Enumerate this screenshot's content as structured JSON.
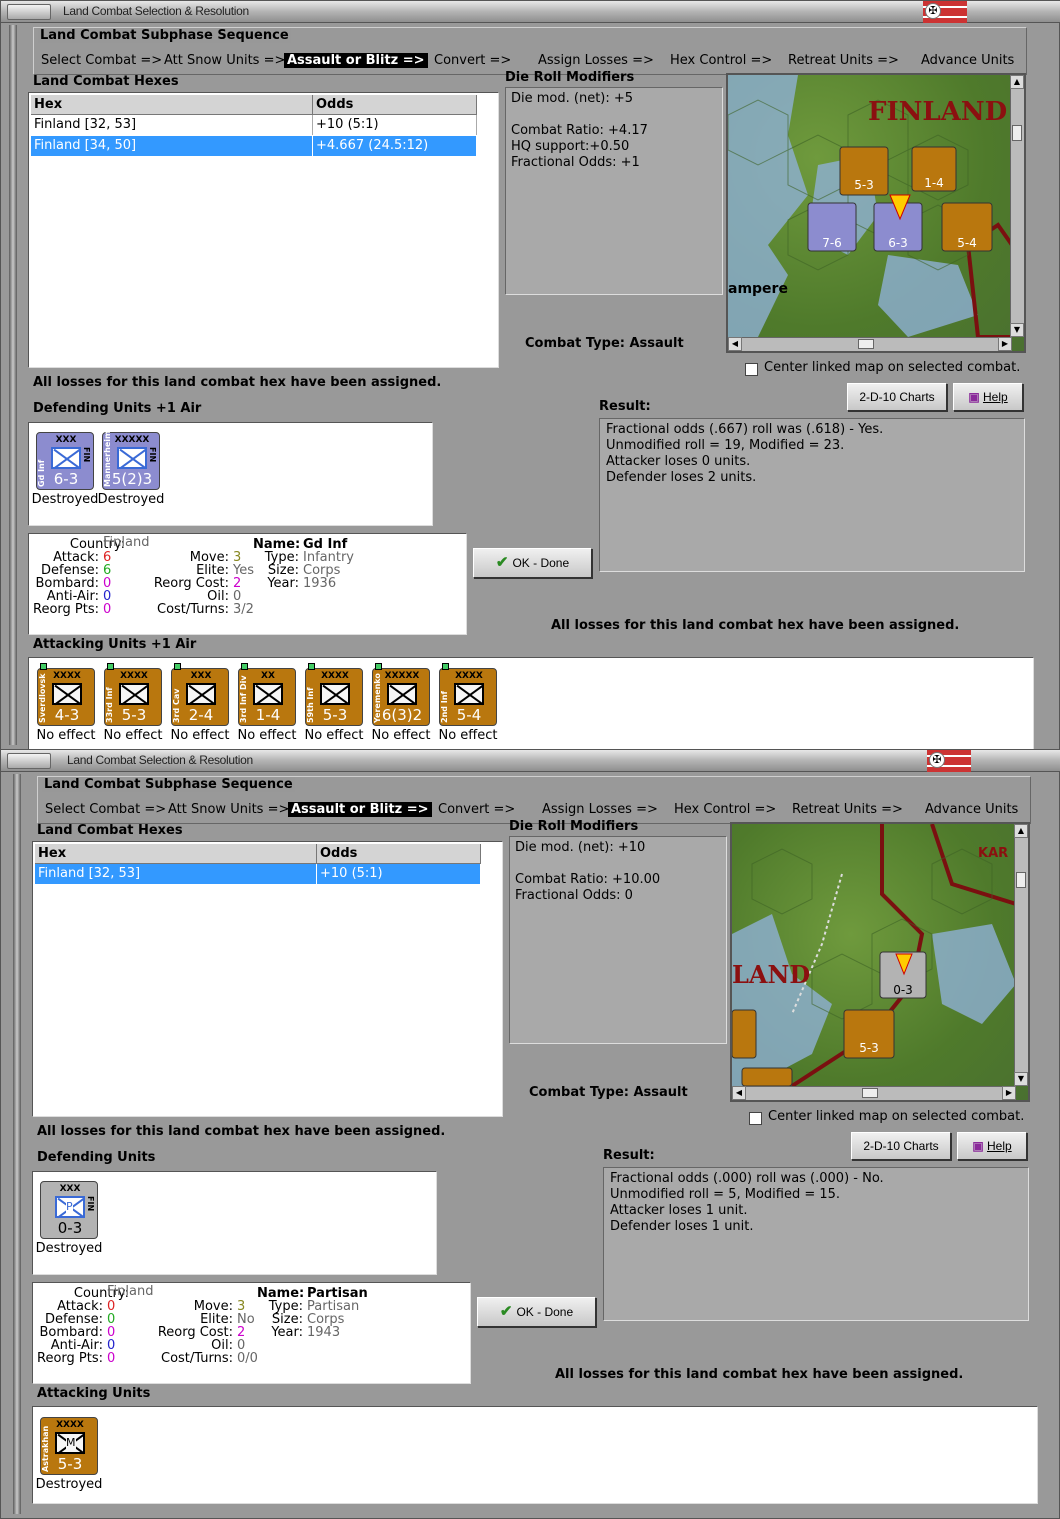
{
  "windows": [
    {
      "title": "Land Combat Selection & Resolution",
      "sequence_title": "Land Combat Subphase Sequence",
      "sequence": [
        "Select Combat =>",
        "Att Snow Units =>",
        "Assault or Blitz =>",
        "Convert =>",
        "Assign Losses =>",
        "Hex Control =>",
        "Retreat Units =>",
        "Advance Units"
      ],
      "hexes_title": "Land Combat Hexes",
      "hex_col": "Hex",
      "odds_col": "Odds",
      "hex_rows": [
        {
          "hex": "Finland [32, 53]",
          "odds": "+10 (5:1)"
        },
        {
          "hex": "Finland [34, 50]",
          "odds": "+4.667 (24.5:12)"
        }
      ],
      "drm_title": "Die Roll Modifiers",
      "drm_lines": [
        "Die mod. (net): +5",
        "",
        "Combat Ratio: +4.17",
        "HQ support:+0.50",
        "Fractional Odds: +1"
      ],
      "map_label": "FINLAND",
      "map_label2": "ampere",
      "combat_type": "Combat Type:  Assault",
      "center_linked": "Center linked map on selected combat.",
      "losses_assigned": "All losses for this land combat hex have been assigned.",
      "charts_btn": "2-D-10 Charts",
      "help_btn": "Help",
      "result_title": "Result:",
      "result_lines": [
        "Fractional odds (.667) roll was (.618)  - Yes.",
        "Unmodified roll = 19, Modified = 23.",
        "Attacker loses 0 units.",
        "Defender loses 2 units."
      ],
      "defending_title": "Defending Units +1 Air",
      "defenders": [
        {
          "size": "XXX",
          "name": "Gd Inf",
          "str": "6-3",
          "status": "Destroyed",
          "nat": "FIN"
        },
        {
          "size": "XXXXX",
          "name": "Mannerheim",
          "str": "5(2)3",
          "status": "Destroyed",
          "nat": "FIN"
        }
      ],
      "info": {
        "country_l": "Country:",
        "country": "Finland",
        "attack_l": "Attack:",
        "attack": "6",
        "defense_l": "Defense:",
        "defense": "6",
        "bombard_l": "Bombard:",
        "bombard": "0",
        "aa_l": "Anti-Air:",
        "aa": "0",
        "reorg_l": "Reorg Pts:",
        "reorg": "0",
        "move_l": "Move:",
        "move": "3",
        "elite_l": "Elite:",
        "elite": "Yes",
        "rcost_l": "Reorg Cost:",
        "rcost": "2",
        "oil_l": "Oil:",
        "oil": "0",
        "cost_l": "Cost/Turns:",
        "cost": "3/2",
        "name_l": "Name:",
        "name": "Gd Inf",
        "type_l": "Type:",
        "type": "Infantry",
        "size_l": "Size:",
        "size": "Corps",
        "year_l": "Year:",
        "year": "1936"
      },
      "ok_btn": "OK - Done",
      "attacking_title": "Attacking Units +1 Air",
      "attackers": [
        {
          "size": "XXXX",
          "name": "Sverdlovsk",
          "str": "4-3",
          "status": "No effect"
        },
        {
          "size": "XXXX",
          "name": "33rd Inf",
          "str": "5-3",
          "status": "No effect"
        },
        {
          "size": "XXX",
          "name": "3rd Cav",
          "str": "2-4",
          "status": "No effect"
        },
        {
          "size": "XX",
          "name": "3rd Inf Div",
          "str": "1-4",
          "status": "No effect"
        },
        {
          "size": "XXXX",
          "name": "59th Inf",
          "str": "5-3",
          "status": "No effect"
        },
        {
          "size": "XXXXX",
          "name": "Yeremenko",
          "str": "6(3)2",
          "status": "No effect"
        },
        {
          "size": "XXXX",
          "name": "2nd Inf",
          "str": "5-4",
          "status": "No effect"
        }
      ]
    },
    {
      "title": "Land Combat Selection & Resolution",
      "sequence_title": "Land Combat Subphase Sequence",
      "sequence": [
        "Select Combat =>",
        "Att Snow Units =>",
        "Assault or Blitz =>",
        "Convert =>",
        "Assign Losses =>",
        "Hex Control =>",
        "Retreat Units =>",
        "Advance Units"
      ],
      "hexes_title": "Land Combat Hexes",
      "hex_col": "Hex",
      "odds_col": "Odds",
      "hex_rows": [
        {
          "hex": "Finland [32, 53]",
          "odds": "+10 (5:1)"
        }
      ],
      "drm_title": "Die Roll Modifiers",
      "drm_lines": [
        "Die mod. (net): +10",
        "",
        "Combat Ratio: +10.00",
        "Fractional Odds: 0"
      ],
      "map_label": "LAND",
      "map_label2": "KAR",
      "combat_type": "Combat Type:  Assault",
      "center_linked": "Center linked map on selected combat.",
      "losses_assigned": "All losses for this land combat hex have been assigned.",
      "charts_btn": "2-D-10 Charts",
      "help_btn": "Help",
      "result_title": "Result:",
      "result_lines": [
        "Fractional odds (.000) roll was (.000)  - No.",
        "Unmodified roll = 5, Modified = 15.",
        "Attacker loses 1 unit.",
        "Defender loses 1 unit."
      ],
      "defending_title": "Defending Units",
      "defenders": [
        {
          "size": "XXX",
          "name": "",
          "str": "0-3",
          "status": "Destroyed",
          "nat": "FIN",
          "letter": "P"
        }
      ],
      "info": {
        "country_l": "Country:",
        "country": "Finland",
        "attack_l": "Attack:",
        "attack": "0",
        "defense_l": "Defense:",
        "defense": "0",
        "bombard_l": "Bombard:",
        "bombard": "0",
        "aa_l": "Anti-Air:",
        "aa": "0",
        "reorg_l": "Reorg Pts:",
        "reorg": "0",
        "move_l": "Move:",
        "move": "3",
        "elite_l": "Elite:",
        "elite": "No",
        "rcost_l": "Reorg Cost:",
        "rcost": "2",
        "oil_l": "Oil:",
        "oil": "0",
        "cost_l": "Cost/Turns:",
        "cost": "0/0",
        "name_l": "Name:",
        "name": "Partisan",
        "type_l": "Type:",
        "type": "Partisan",
        "size_l": "Size:",
        "size": "Corps",
        "year_l": "Year:",
        "year": "1943"
      },
      "ok_btn": "OK - Done",
      "attacking_title": "Attacking Units",
      "attackers": [
        {
          "size": "XXXX",
          "name": "Astrakhan",
          "str": "5-3",
          "status": "Destroyed",
          "letter": "M"
        }
      ]
    }
  ]
}
